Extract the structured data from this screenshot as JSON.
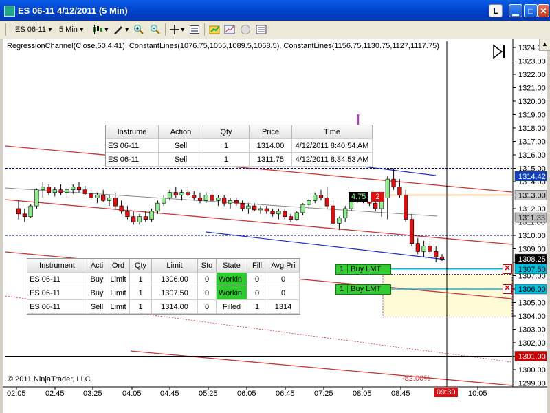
{
  "window": {
    "title": "ES 06-11  4/12/2011 (5 Min)",
    "buttons": {
      "lang": "L",
      "minimize": "▁",
      "maximize": "□",
      "close": "✕"
    }
  },
  "toolbar": {
    "instrument": "ES 06-11",
    "interval": "5 Min",
    "icons": [
      "candlestick-style-icon",
      "draw-tool-icon",
      "zoom-in-icon",
      "zoom-out-icon",
      "crosshair-icon",
      "properties-icon",
      "strategies-icon",
      "indicators-icon",
      "simulated-data-icon",
      "chart-trader-icon"
    ]
  },
  "indicators_label": "RegressionChannel(Close,50,4.41), ConstantLines(1076.75,1055,1089.5,1068.5), ConstantLines(1156.75,1130.75,1127,1117.75)",
  "copyright": "© 2011 NinjaTrader, LLC",
  "percent_label": "-82.00%",
  "price_axis": {
    "ticks": [
      "1324.0",
      "1323.00",
      "1322.00",
      "1321.00",
      "1320.00",
      "1319.00",
      "1318.00",
      "1317.00",
      "1316.00",
      "1315.00",
      "1314.00",
      "1313.00",
      "1312.00",
      "1311.00",
      "1310.00",
      "1309.00",
      "1308.00",
      "1307.00",
      "1306.00",
      "1305.00",
      "1304.00",
      "1303.00",
      "1302.00",
      "1301.00",
      "1300.00",
      "1299.00"
    ],
    "markers": [
      {
        "label": "1314.42",
        "bg": "#1040c0",
        "fg": "#ffffff"
      },
      {
        "label": "1313.00",
        "bg": "#cccccc",
        "fg": "#000000"
      },
      {
        "label": "1311.33",
        "bg": "#bbbbbb",
        "fg": "#000000"
      },
      {
        "label": "1308.25",
        "bg": "#000000",
        "fg": "#ffffff"
      },
      {
        "label": "1307.50",
        "bg": "#00bfe0",
        "fg": "#000000"
      },
      {
        "label": "1306.00",
        "bg": "#00bfe0",
        "fg": "#000000"
      },
      {
        "label": "1301.00",
        "bg": "#cc0000",
        "fg": "#ffffff"
      }
    ]
  },
  "time_axis": {
    "ticks": [
      "02:05",
      "02:45",
      "03:25",
      "04:05",
      "04:45",
      "05:25",
      "06:05",
      "06:45",
      "07:25",
      "08:05",
      "08:45",
      "10:05"
    ],
    "current_time": "09:30"
  },
  "position_badge": {
    "pnl": "4.75",
    "qty": "2"
  },
  "executions_grid": {
    "columns": [
      "Instrume",
      "Action",
      "Qty",
      "Price",
      "Time"
    ],
    "rows": [
      [
        "ES 06-11",
        "Sell",
        "1",
        "1314.00",
        "4/12/2011 8:40:54 AM"
      ],
      [
        "ES 06-11",
        "Sell",
        "1",
        "1311.75",
        "4/12/2011 8:34:53 AM"
      ]
    ]
  },
  "orders_grid": {
    "columns": [
      "Instrument",
      "Acti",
      "Ord",
      "Qty",
      "Limit",
      "Sto",
      "State",
      "Fill",
      "Avg Pri"
    ],
    "rows": [
      [
        "ES 06-11",
        "Buy",
        "Limit",
        "1",
        "1306.00",
        "0",
        "Workin",
        "0",
        "0"
      ],
      [
        "ES 06-11",
        "Buy",
        "Limit",
        "1",
        "1307.50",
        "0",
        "Workin",
        "0",
        "0"
      ],
      [
        "ES 06-11",
        "Sell",
        "Limit",
        "1",
        "1314.00",
        "0",
        "Filled",
        "1",
        "1314"
      ]
    ]
  },
  "order_tags": [
    {
      "qty": "1",
      "label": "Buy LMT",
      "price": "1307.50"
    },
    {
      "qty": "1",
      "label": "Buy LMT",
      "price": "1306.00"
    }
  ],
  "colors": {
    "regression_channel": "#cc3333",
    "constant_line": "#000080",
    "up_candle": "#90ee90",
    "down_candle": "#dd1111",
    "blue_channel": "#1a2fd0"
  }
}
